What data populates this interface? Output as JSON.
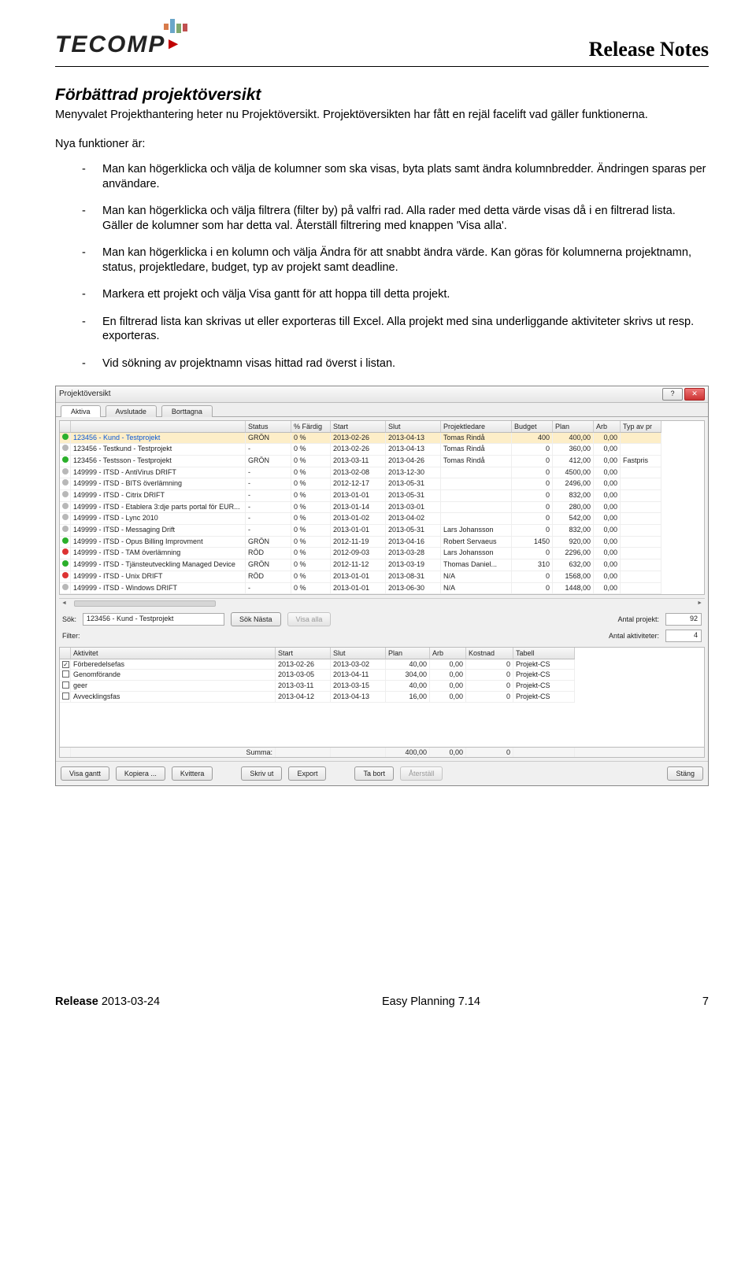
{
  "header": {
    "doc_title": "Release Notes",
    "logo_text": "TECOMP"
  },
  "section_title": "Förbättrad projektöversikt",
  "lead": "Menyvalet Projekthantering heter nu Projektöversikt. Projektöversikten har fått en rejäl facelift vad gäller funktionerna.",
  "intro": "Nya funktioner är:",
  "bullets": [
    "Man kan högerklicka och välja de kolumner som ska visas, byta plats samt ändra kolumnbredder. Ändringen sparas per användare.",
    "Man kan högerklicka och välja filtrera (filter by) på valfri rad. Alla rader med detta värde visas då i en filtrerad lista. Gäller de kolumner som har detta val. Återställ filtrering med knappen 'Visa alla'.",
    "Man kan högerklicka i en kolumn och välja Ändra för att snabbt ändra värde. Kan göras för kolumnerna projektnamn, status, projektledare, budget, typ av projekt samt deadline.",
    "Markera ett projekt och välja Visa gantt för att hoppa till detta projekt.",
    "En filtrerad lista kan skrivas ut eller exporteras till Excel. Alla projekt med sina underliggande aktiviteter skrivs ut resp. exporteras.",
    "Vid sökning av projektnamn visas hittad rad överst i listan."
  ],
  "win": {
    "title": "Projektöversikt",
    "tabs": [
      "Aktiva",
      "Avslutade",
      "Borttagna"
    ],
    "help": "?",
    "columns": [
      "",
      "",
      "Status",
      "% Färdig",
      "Start",
      "Slut",
      "Projektledare",
      "Budget",
      "Plan",
      "Arb",
      "Typ av pr"
    ],
    "rows": [
      {
        "dot": "g",
        "name": "123456 - Kund - Testprojekt",
        "status": "GRÖN",
        "pct": "0 %",
        "start": "2013-02-26",
        "slut": "2013-04-13",
        "pl": "Tomas Rindå",
        "budget": "400",
        "plan": "400,00",
        "arb": "0,00",
        "typ": "",
        "sel": true
      },
      {
        "dot": "gray",
        "name": "123456 - Testkund - Testprojekt",
        "status": "-",
        "pct": "0 %",
        "start": "2013-02-26",
        "slut": "2013-04-13",
        "pl": "Tomas Rindå",
        "budget": "0",
        "plan": "360,00",
        "arb": "0,00",
        "typ": ""
      },
      {
        "dot": "g",
        "name": "123456 - Testsson - Testprojekt",
        "status": "GRÖN",
        "pct": "0 %",
        "start": "2013-03-11",
        "slut": "2013-04-26",
        "pl": "Tomas Rindå",
        "budget": "0",
        "plan": "412,00",
        "arb": "0,00",
        "typ": "Fastpris"
      },
      {
        "dot": "gray",
        "name": "149999 - ITSD - AntiVirus DRIFT",
        "status": "-",
        "pct": "0 %",
        "start": "2013-02-08",
        "slut": "2013-12-30",
        "pl": "",
        "budget": "0",
        "plan": "4500,00",
        "arb": "0,00",
        "typ": ""
      },
      {
        "dot": "gray",
        "name": "149999 - ITSD - BITS överlämning",
        "status": "-",
        "pct": "0 %",
        "start": "2012-12-17",
        "slut": "2013-05-31",
        "pl": "",
        "budget": "0",
        "plan": "2496,00",
        "arb": "0,00",
        "typ": ""
      },
      {
        "dot": "gray",
        "name": "149999 - ITSD - Citrix DRIFT",
        "status": "-",
        "pct": "0 %",
        "start": "2013-01-01",
        "slut": "2013-05-31",
        "pl": "",
        "budget": "0",
        "plan": "832,00",
        "arb": "0,00",
        "typ": ""
      },
      {
        "dot": "gray",
        "name": "149999 - ITSD - Etablera 3:dje parts portal för EUR...",
        "status": "-",
        "pct": "0 %",
        "start": "2013-01-14",
        "slut": "2013-03-01",
        "pl": "",
        "budget": "0",
        "plan": "280,00",
        "arb": "0,00",
        "typ": ""
      },
      {
        "dot": "gray",
        "name": "149999 - ITSD - Lync 2010",
        "status": "-",
        "pct": "0 %",
        "start": "2013-01-02",
        "slut": "2013-04-02",
        "pl": "",
        "budget": "0",
        "plan": "542,00",
        "arb": "0,00",
        "typ": ""
      },
      {
        "dot": "gray",
        "name": "149999 - ITSD - Messaging Drift",
        "status": "-",
        "pct": "0 %",
        "start": "2013-01-01",
        "slut": "2013-05-31",
        "pl": "Lars Johansson",
        "budget": "0",
        "plan": "832,00",
        "arb": "0,00",
        "typ": ""
      },
      {
        "dot": "g",
        "name": "149999 - ITSD - Opus Billing Improvment",
        "status": "GRÖN",
        "pct": "0 %",
        "start": "2012-11-19",
        "slut": "2013-04-16",
        "pl": "Robert Servaeus",
        "budget": "1450",
        "plan": "920,00",
        "arb": "0,00",
        "typ": ""
      },
      {
        "dot": "r",
        "name": "149999 - ITSD - TAM överlämning",
        "status": "RÖD",
        "pct": "0 %",
        "start": "2012-09-03",
        "slut": "2013-03-28",
        "pl": "Lars Johansson",
        "budget": "0",
        "plan": "2296,00",
        "arb": "0,00",
        "typ": ""
      },
      {
        "dot": "g",
        "name": "149999 - ITSD - Tjänsteutveckling Managed Device",
        "status": "GRÖN",
        "pct": "0 %",
        "start": "2012-11-12",
        "slut": "2013-03-19",
        "pl": "Thomas Daniel...",
        "budget": "310",
        "plan": "632,00",
        "arb": "0,00",
        "typ": ""
      },
      {
        "dot": "r",
        "name": "149999 - ITSD - Unix DRIFT",
        "status": "RÖD",
        "pct": "0 %",
        "start": "2013-01-01",
        "slut": "2013-08-31",
        "pl": "N/A",
        "budget": "0",
        "plan": "1568,00",
        "arb": "0,00",
        "typ": ""
      },
      {
        "dot": "gray",
        "name": "149999 - ITSD - Windows DRIFT",
        "status": "-",
        "pct": "0 %",
        "start": "2013-01-01",
        "slut": "2013-06-30",
        "pl": "N/A",
        "budget": "0",
        "plan": "1448,00",
        "arb": "0,00",
        "typ": ""
      }
    ],
    "sok_label": "Sök:",
    "sok_value": "123456 - Kund - Testprojekt",
    "btn_soknasta": "Sök Nästa",
    "btn_visaalla": "Visa alla",
    "filter_label": "Filter:",
    "antal_proj_label": "Antal projekt:",
    "antal_proj": "92",
    "antal_akt_label": "Antal aktiviteter:",
    "antal_akt": "4",
    "cols2": [
      "",
      "Aktivitet",
      "Start",
      "Slut",
      "Plan",
      "Arb",
      "Kostnad",
      "Tabell"
    ],
    "rows2": [
      {
        "chk": true,
        "akt": "Förberedelsefas",
        "start": "2013-02-26",
        "slut": "2013-03-02",
        "plan": "40,00",
        "arb": "0,00",
        "kost": "0",
        "tab": "Projekt-CS"
      },
      {
        "chk": false,
        "akt": "Genomförande",
        "start": "2013-03-05",
        "slut": "2013-04-11",
        "plan": "304,00",
        "arb": "0,00",
        "kost": "0",
        "tab": "Projekt-CS"
      },
      {
        "chk": false,
        "akt": "geer",
        "start": "2013-03-11",
        "slut": "2013-03-15",
        "plan": "40,00",
        "arb": "0,00",
        "kost": "0",
        "tab": "Projekt-CS"
      },
      {
        "chk": false,
        "akt": "Avvecklingsfas",
        "start": "2013-04-12",
        "slut": "2013-04-13",
        "plan": "16,00",
        "arb": "0,00",
        "kost": "0",
        "tab": "Projekt-CS"
      }
    ],
    "sumrow": {
      "label": "Summa:",
      "plan": "400,00",
      "arb": "0,00",
      "kost": "0"
    },
    "btns": {
      "visa_gantt": "Visa gantt",
      "kopiera": "Kopiera ...",
      "kvittera": "Kvittera",
      "skrivut": "Skriv ut",
      "export": "Export",
      "tabort": "Ta bort",
      "aterstall": "Återställ",
      "stang": "Stäng"
    }
  },
  "footer": {
    "release_label": "Release",
    "release_date": "2013-03-24",
    "product": "Easy Planning 7.14",
    "page": "7"
  }
}
